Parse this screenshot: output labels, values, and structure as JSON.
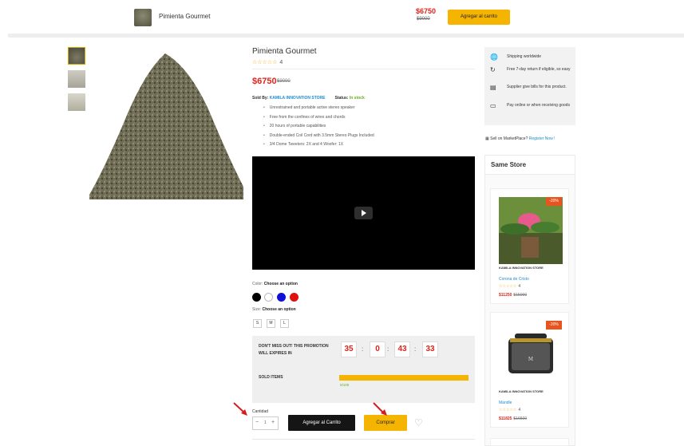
{
  "sticky_bar": {
    "product_name": "Pimienta Gourmet",
    "price": "$6750",
    "old_price": "$9000",
    "add_to_cart": "Agregar al carrito"
  },
  "product": {
    "title": "Pimienta Gourmet",
    "rating_stars": "☆☆☆☆☆",
    "rating_count": "4",
    "price": "$6750",
    "old_price": "$9000",
    "sold_by_label": "Sold By:",
    "store": "KAMILA INNOVATION STORE",
    "status_label": "Status:",
    "status": "In stock",
    "features": [
      "Unrestrained and portable active stereo speaker",
      "Free from the confines of wires and chords",
      "20 hours of portable capabilities",
      "Double-ended Coil Cord with 3.5mm Stereo Plugs Included",
      "3/4 Dome Tweeters: 2X and 4 Woofer: 1X"
    ]
  },
  "variations": {
    "color_label": "Color:",
    "color_value": "Choose an option",
    "colors": [
      "#000000",
      "#ffffff",
      "#1010d8",
      "#e01010"
    ],
    "size_label": "Size:",
    "size_value": "Choose an option",
    "sizes": [
      "S",
      "M",
      "L"
    ]
  },
  "countdown": {
    "message": "DON'T MISS OUT! THIS PROMOTION WILL EXPIRES IN",
    "days": "35",
    "hours": "0",
    "minutes": "43",
    "seconds": "33",
    "sold_label": "SOLD ITEMS",
    "sold_fraction": 1.0,
    "sold_text": "0/100"
  },
  "purchase": {
    "qty_label": "Cantidad",
    "qty_value": "1",
    "minus": "−",
    "plus": "+",
    "add_to_cart": "Agregar al Carrito",
    "buy_now": "Comprar",
    "wishlist_icon": "♡"
  },
  "sidebar": {
    "info": [
      {
        "icon": "globe-icon",
        "glyph": "🌐",
        "text": "Shipping worldwide"
      },
      {
        "icon": "return-icon",
        "glyph": "↻",
        "text": "Free 7-day return if eligible, so easy"
      },
      {
        "icon": "bill-icon",
        "glyph": "▤",
        "text": "Supplier give bills for this product."
      },
      {
        "icon": "card-icon",
        "glyph": "▭",
        "text": "Pay online or when receiving goods"
      }
    ],
    "sell_text": "Sell on MarketPlace?",
    "sell_link": "Register Now !",
    "same_store_title": "Same Store",
    "cards": [
      {
        "badge": "-20%",
        "store": "KAMILA INNOVATION STORE",
        "name": "Corona de Cristo",
        "stars": "☆☆☆☆☆",
        "count": "4",
        "price": "$11250",
        "old": "$15000"
      },
      {
        "badge": "-20%",
        "store": "KAMILA INNOVATION STORE",
        "name": "Mandle",
        "stars": "☆☆☆☆☆",
        "count": "4",
        "price": "$11825",
        "old": "$16500"
      }
    ]
  },
  "colors": {
    "accent": "#f5b400",
    "price": "#e2231a",
    "link": "#1f8ccf",
    "stock": "#6bab1f"
  }
}
